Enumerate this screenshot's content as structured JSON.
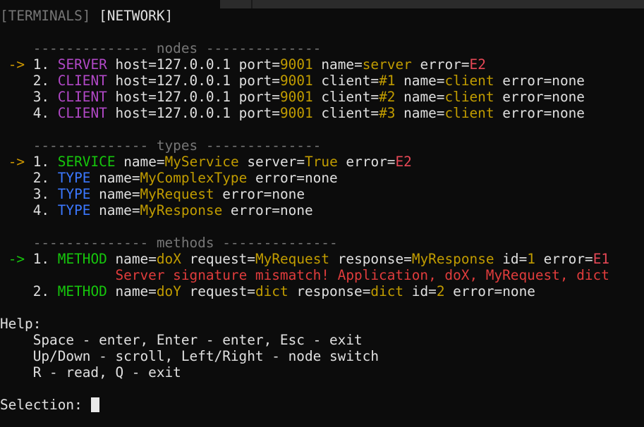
{
  "window": {
    "tabs": [
      {
        "label": "[TERMINALS]",
        "active": false
      },
      {
        "label": "[NETWORK]",
        "active": true
      }
    ]
  },
  "sections": {
    "nodes": {
      "header": "-------------- nodes --------------",
      "rows": [
        {
          "selector": "->",
          "index": "1.",
          "kind": "SERVER",
          "host": "127.0.0.1",
          "port": "9001",
          "client": "",
          "name": "server",
          "error": "E2"
        },
        {
          "selector": "",
          "index": "2.",
          "kind": "CLIENT",
          "host": "127.0.0.1",
          "port": "9001",
          "client": "#1",
          "name": "client",
          "error": "none"
        },
        {
          "selector": "",
          "index": "3.",
          "kind": "CLIENT",
          "host": "127.0.0.1",
          "port": "9001",
          "client": "#2",
          "name": "client",
          "error": "none"
        },
        {
          "selector": "",
          "index": "4.",
          "kind": "CLIENT",
          "host": "127.0.0.1",
          "port": "9001",
          "client": "#3",
          "name": "client",
          "error": "none"
        }
      ]
    },
    "types": {
      "header": "-------------- types --------------",
      "rows": [
        {
          "selector": "->",
          "index": "1.",
          "kind": "SERVICE",
          "name": "MyService",
          "server": "True",
          "error": "E2"
        },
        {
          "selector": "",
          "index": "2.",
          "kind": "TYPE",
          "name": "MyComplexType",
          "error": "none"
        },
        {
          "selector": "",
          "index": "3.",
          "kind": "TYPE",
          "name": "MyRequest",
          "error": "none"
        },
        {
          "selector": "",
          "index": "4.",
          "kind": "TYPE",
          "name": "MyResponse",
          "error": "none"
        }
      ]
    },
    "methods": {
      "header": "-------------- methods --------------",
      "rows": [
        {
          "selector": "->",
          "index": "1.",
          "kind": "METHOD",
          "name": "doX",
          "request": "MyRequest",
          "response": "MyResponse",
          "id": "1",
          "error": "E1",
          "error_message": "Server signature mismatch! Application, doX, MyRequest, dict"
        },
        {
          "selector": "",
          "index": "2.",
          "kind": "METHOD",
          "name": "doY",
          "request": "dict",
          "response": "dict",
          "id": "2",
          "error": "none"
        }
      ]
    }
  },
  "help": {
    "title": "Help:",
    "lines": [
      "Space - enter, Enter - enter, Esc - exit",
      "Up/Down - scroll, Left/Right - node switch",
      "R - read, Q - exit"
    ]
  },
  "prompt": {
    "label": "Selection:",
    "value": ""
  },
  "colors": {
    "background": "#0c0c0c",
    "foreground": "#e0e0e0",
    "muted": "#767676",
    "server_kind": "#b148c6",
    "service_kind": "#16c60c",
    "type_kind": "#3b78ff",
    "value": "#c19c00",
    "error": "#e74856",
    "selector_orange": "#c19c00",
    "selector_green": "#16c60c"
  }
}
